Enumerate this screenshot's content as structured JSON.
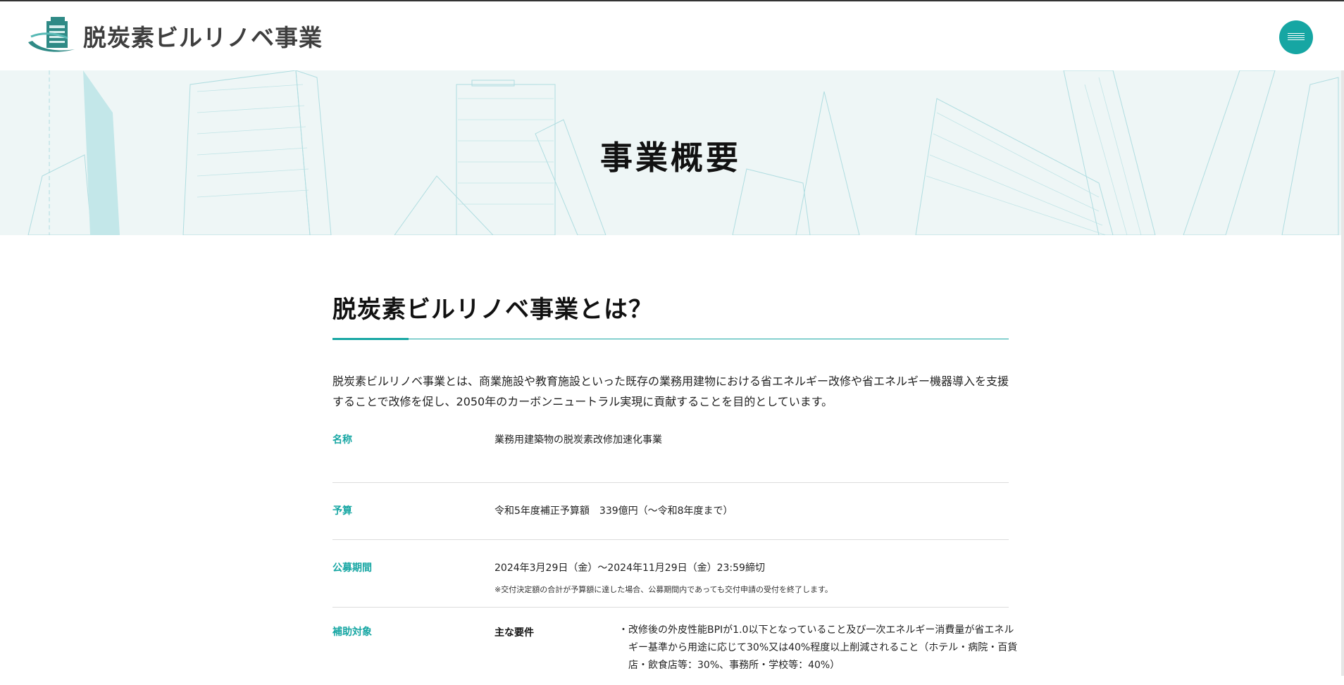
{
  "header": {
    "logo_text": "脱炭素ビルリノベ事業"
  },
  "hero": {
    "title": "事業概要"
  },
  "section": {
    "title": "脱炭素ビルリノベ事業とは？",
    "intro": "脱炭素ビルリノベ事業とは、商業施設や教育施設といった既存の業務用建物における省エネルギー改修や省エネルギー機器導入を支援することで改修を促し、2050年のカーボンニュートラル実現に貢献することを目的としています。"
  },
  "info": {
    "name": {
      "label": "名称",
      "value": "業務用建築物の脱炭素改修加速化事業"
    },
    "budget": {
      "label": "予算",
      "value": "令和5年度補正予算額　339億円（〜令和8年度まで）"
    },
    "period": {
      "label": "公募期間",
      "value": "2024年3月29日（金）〜2024年11月29日（金）23:59締切",
      "note": "※交付決定額の合計が予算額に達した場合、公募期間内であっても交付申請の受付を終了します。"
    },
    "target": {
      "label": "補助対象",
      "sub_label": "主な要件",
      "bullet": "・改修後の外皮性能BPIが1.0以下となっていること及び一次エネルギー消費量が省エネルギー基準から用途に応じて30%又は40%程度以上削減されること（ホテル・病院・百貨店・飲食店等：30%、事務所・学校等：40%）"
    }
  },
  "colors": {
    "accent": "#16a6a3",
    "hero_bg": "#eef6f6"
  },
  "icons": {
    "menu": "hamburger-menu-icon",
    "logo": "building-logo-icon"
  }
}
